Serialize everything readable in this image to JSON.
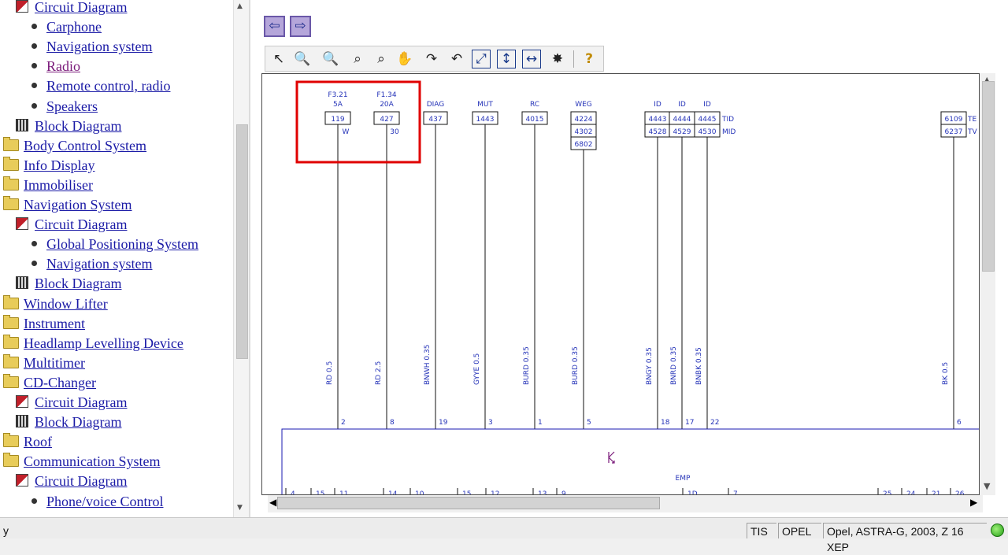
{
  "tree": [
    {
      "icon": "book-red-icon",
      "label": "Circuit Diagram",
      "indent": 1,
      "visited": false
    },
    {
      "icon": "bullet-icon",
      "label": "Carphone",
      "indent": 2,
      "visited": false
    },
    {
      "icon": "bullet-icon",
      "label": "Navigation system",
      "indent": 2,
      "visited": false
    },
    {
      "icon": "bullet-icon",
      "label": "Radio",
      "indent": 2,
      "visited": true
    },
    {
      "icon": "bullet-icon",
      "label": "Remote control, radio",
      "indent": 2,
      "visited": false
    },
    {
      "icon": "bullet-icon",
      "label": "Speakers",
      "indent": 2,
      "visited": false
    },
    {
      "icon": "book-block-icon",
      "label": "Block Diagram",
      "indent": 1,
      "visited": false
    },
    {
      "icon": "folder-icon",
      "label": "Body Control System",
      "indent": 0,
      "visited": false
    },
    {
      "icon": "folder-icon",
      "label": "Info Display",
      "indent": 0,
      "visited": false
    },
    {
      "icon": "folder-icon",
      "label": "Immobiliser",
      "indent": 0,
      "visited": false
    },
    {
      "icon": "folder-open-icon",
      "label": "Navigation System",
      "indent": 0,
      "visited": false
    },
    {
      "icon": "book-red-icon",
      "label": "Circuit Diagram",
      "indent": 1,
      "visited": false
    },
    {
      "icon": "bullet-icon",
      "label": "Global Positioning System",
      "indent": 2,
      "visited": false
    },
    {
      "icon": "bullet-icon",
      "label": "Navigation system",
      "indent": 2,
      "visited": false
    },
    {
      "icon": "book-block-icon",
      "label": "Block Diagram",
      "indent": 1,
      "visited": false
    },
    {
      "icon": "folder-icon",
      "label": "Window Lifter",
      "indent": 0,
      "visited": false
    },
    {
      "icon": "folder-icon",
      "label": "Instrument",
      "indent": 0,
      "visited": false
    },
    {
      "icon": "folder-icon",
      "label": "Headlamp Levelling Device",
      "indent": 0,
      "visited": false
    },
    {
      "icon": "folder-icon",
      "label": "Multitimer",
      "indent": 0,
      "visited": false
    },
    {
      "icon": "folder-open-icon",
      "label": "CD-Changer",
      "indent": 0,
      "visited": false
    },
    {
      "icon": "book-red-icon",
      "label": "Circuit Diagram",
      "indent": 1,
      "visited": false
    },
    {
      "icon": "book-block-icon",
      "label": "Block Diagram",
      "indent": 1,
      "visited": false
    },
    {
      "icon": "folder-icon",
      "label": "Roof",
      "indent": 0,
      "visited": false
    },
    {
      "icon": "folder-open-icon",
      "label": "Communication System",
      "indent": 0,
      "visited": false
    },
    {
      "icon": "book-red-icon",
      "label": "Circuit Diagram",
      "indent": 1,
      "visited": false
    },
    {
      "icon": "bullet-icon",
      "label": "Phone/voice Control",
      "indent": 2,
      "visited": false
    }
  ],
  "nav": {
    "back_glyph": "⇦",
    "forward_glyph": "⇨"
  },
  "toolbar": [
    {
      "name": "select-arrow-icon",
      "glyph": "↖"
    },
    {
      "name": "zoom-in-icon",
      "glyph": "🔍"
    },
    {
      "name": "zoom-out-icon",
      "glyph": "🔍"
    },
    {
      "name": "zoom-icon",
      "glyph": "⌕"
    },
    {
      "name": "zoom-window-icon",
      "glyph": "⌕"
    },
    {
      "name": "hand-pan-icon",
      "glyph": "✋"
    },
    {
      "name": "rotate-cw-icon",
      "glyph": "↷"
    },
    {
      "name": "rotate-ccw-icon",
      "glyph": "↶"
    },
    {
      "name": "fit-window-icon",
      "glyph": "⤢"
    },
    {
      "name": "fit-height-icon",
      "glyph": "↕"
    },
    {
      "name": "fit-width-icon",
      "glyph": "↔"
    },
    {
      "name": "highlight-icon",
      "glyph": "✸"
    },
    {
      "name": "help-icon",
      "glyph": "?"
    }
  ],
  "diagram": {
    "fuses": [
      {
        "name": "F3.21",
        "rating": "5A",
        "terminal": "119",
        "color": "W",
        "wire": "RD 0.5",
        "pin": "2"
      },
      {
        "name": "F1.34",
        "rating": "20A",
        "terminal": "427",
        "color": "30",
        "wire": "RD 2.5",
        "pin": "8"
      }
    ],
    "signals": [
      {
        "label": "DIAG",
        "terminals": [
          "437"
        ],
        "wire": "BNWH 0.35",
        "pin": "19"
      },
      {
        "label": "MUT",
        "terminals": [
          "1443"
        ],
        "wire": "GYYE 0.5",
        "pin": "3"
      },
      {
        "label": "RC",
        "terminals": [
          "4015"
        ],
        "wire": "BURD 0.35",
        "pin": "1"
      },
      {
        "label": "WEG",
        "terminals": [
          "4224",
          "4302",
          "6802"
        ],
        "wire": "BURD 0.35",
        "pin": "5"
      },
      {
        "label": "ID",
        "terminals": [
          "4443",
          "4528"
        ],
        "wire": "BNGY 0.35",
        "pin": "18"
      },
      {
        "label": "ID",
        "terminals": [
          "4444",
          "4529"
        ],
        "wire": "BNRD 0.35",
        "pin": "17"
      },
      {
        "label": "ID",
        "terminals": [
          "4445",
          "4530"
        ],
        "wire": "BNBK 0.35",
        "pin": "22"
      },
      {
        "label": "",
        "terminals": [
          "6109",
          "6237"
        ],
        "wire": "BK 0.5",
        "pin": "6"
      }
    ],
    "side_labels": [
      "TID",
      "MID",
      "TE",
      "TV"
    ],
    "component_label": "EMP",
    "bottom_pins": [
      "4",
      "15",
      "11",
      "14",
      "10",
      "15",
      "12",
      "13",
      "9",
      "1D",
      "7",
      "25",
      "24",
      "21",
      "26"
    ]
  },
  "status": {
    "left": "y",
    "tis": "TIS",
    "brand": "OPEL",
    "vehicle": "Opel, ASTRA-G, 2003, Z 16 XEP"
  }
}
